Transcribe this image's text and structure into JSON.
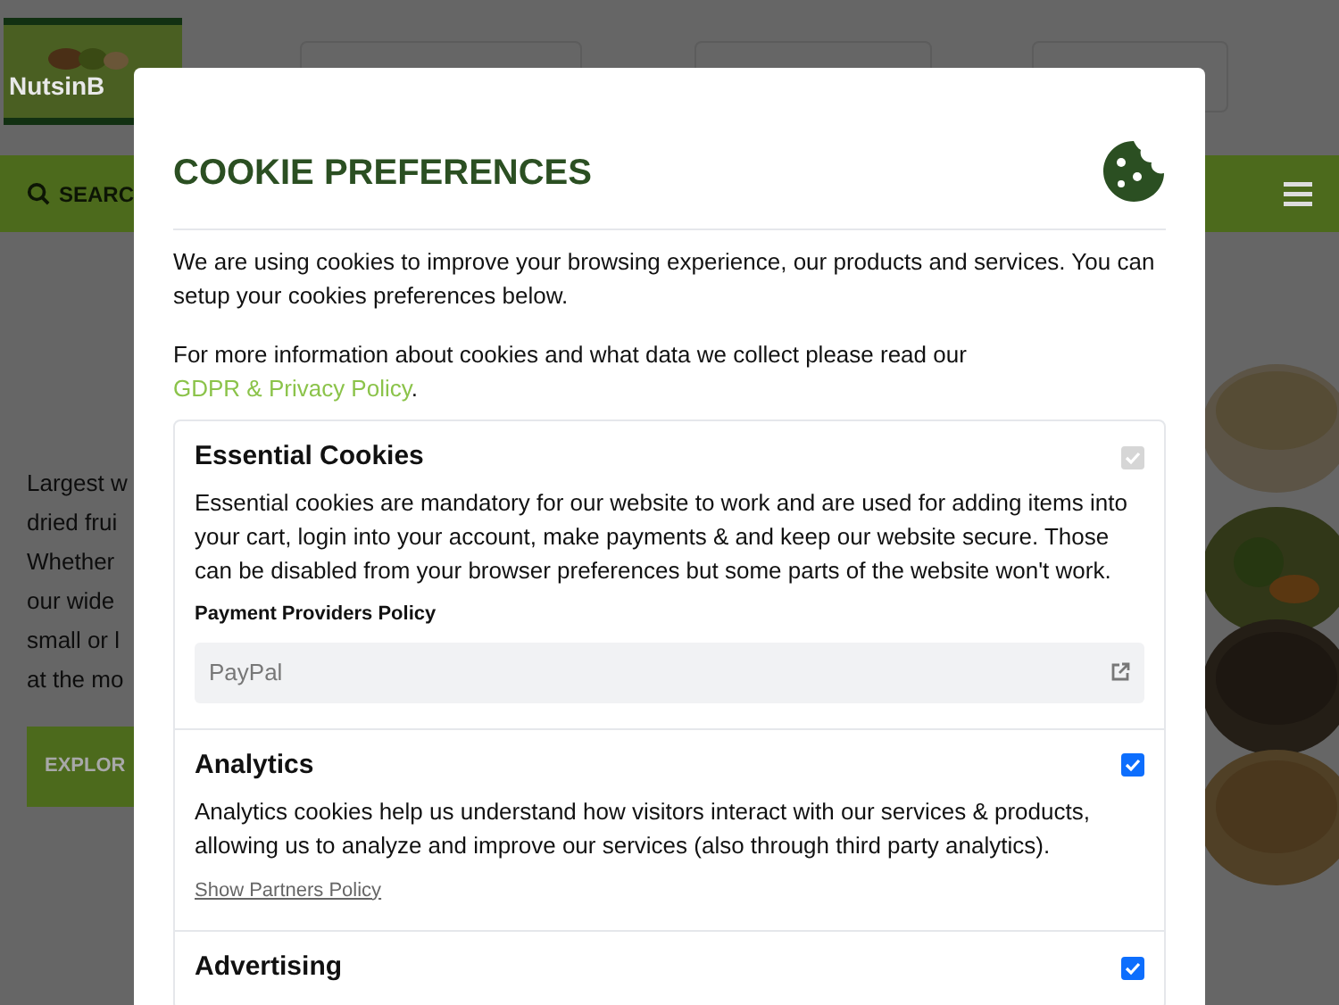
{
  "background": {
    "logo_text": "NutsinB",
    "search_label": "SEARC",
    "intro_lines": [
      "Largest w",
      "dried frui",
      "Whether",
      "our wide",
      "small or l",
      "at the mo"
    ],
    "explore_button": "EXPLOR"
  },
  "modal": {
    "title": "COOKIE PREFERENCES",
    "intro": "We are using cookies to improve your browsing experience, our products and services. You can setup your cookies preferences below.",
    "more_info": "For more information about cookies and what data we collect please read our",
    "privacy_link": "GDPR & Privacy Policy",
    "privacy_suffix": ".",
    "categories": [
      {
        "title": "Essential Cookies",
        "checked": true,
        "disabled": true,
        "description": "Essential cookies are mandatory for our website to work and are used for adding items into your cart, login into your account, make payments & and keep our website secure. Those can be disabled from your browser preferences but some parts of the website won't work.",
        "policy_label": "Payment Providers Policy",
        "providers": [
          "PayPal"
        ]
      },
      {
        "title": "Analytics",
        "checked": true,
        "disabled": false,
        "description": "Analytics cookies help us understand how visitors interact with our services & products, allowing us to analyze and improve our services (also through third party analytics).",
        "policy_link": "Show Partners Policy"
      },
      {
        "title": "Advertising",
        "checked": true,
        "disabled": false
      }
    ]
  }
}
